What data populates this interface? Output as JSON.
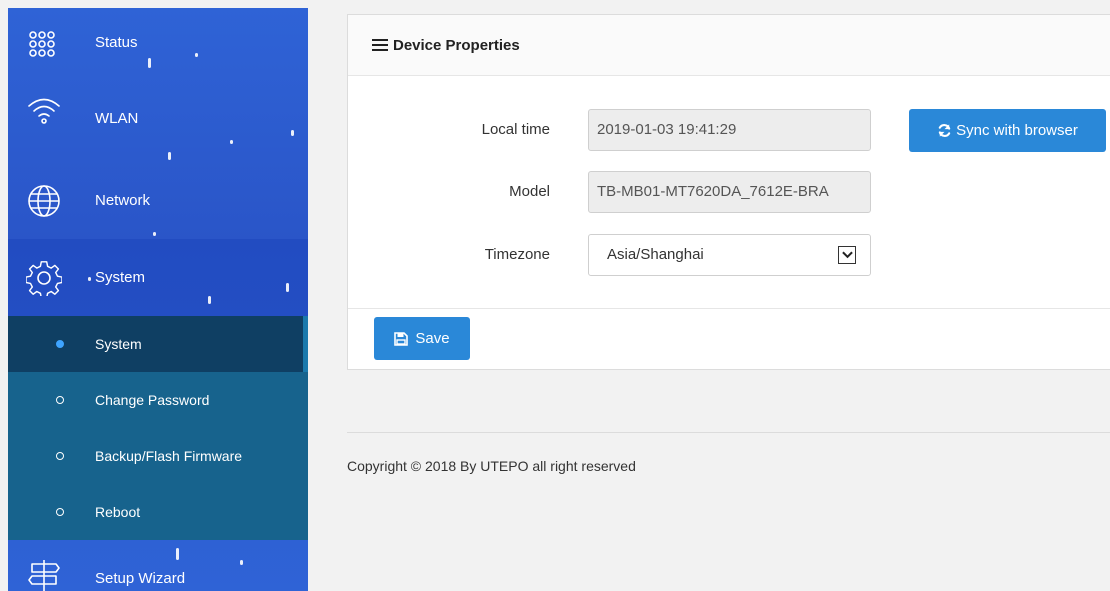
{
  "sidebar": {
    "items": [
      {
        "label": "Status",
        "icon": "dots-grid-icon"
      },
      {
        "label": "WLAN",
        "icon": "wifi-icon"
      },
      {
        "label": "Network",
        "icon": "globe-icon"
      },
      {
        "label": "System",
        "icon": "gear-icon"
      },
      {
        "label": "Setup Wizard",
        "icon": "signpost-icon"
      }
    ],
    "submenu": [
      {
        "label": "System"
      },
      {
        "label": "Change Password"
      },
      {
        "label": "Backup/Flash Firmware"
      },
      {
        "label": "Reboot"
      }
    ]
  },
  "panel": {
    "title": "Device Properties",
    "local_time_label": "Local time",
    "local_time_value": "2019-01-03 19:41:29",
    "sync_button": "Sync with browser",
    "model_label": "Model",
    "model_value": "TB-MB01-MT7620DA_7612E-BRA",
    "timezone_label": "Timezone",
    "timezone_value": "Asia/Shanghai",
    "save_button": "Save"
  },
  "footer": {
    "copyright": "Copyright © 2018 By UTEPO all right reserved"
  },
  "colors": {
    "sidebar_blue": "#2f63d6",
    "submenu_teal": "#17638d",
    "submenu_active": "#0f3f63",
    "button_blue": "#2a88d8"
  }
}
